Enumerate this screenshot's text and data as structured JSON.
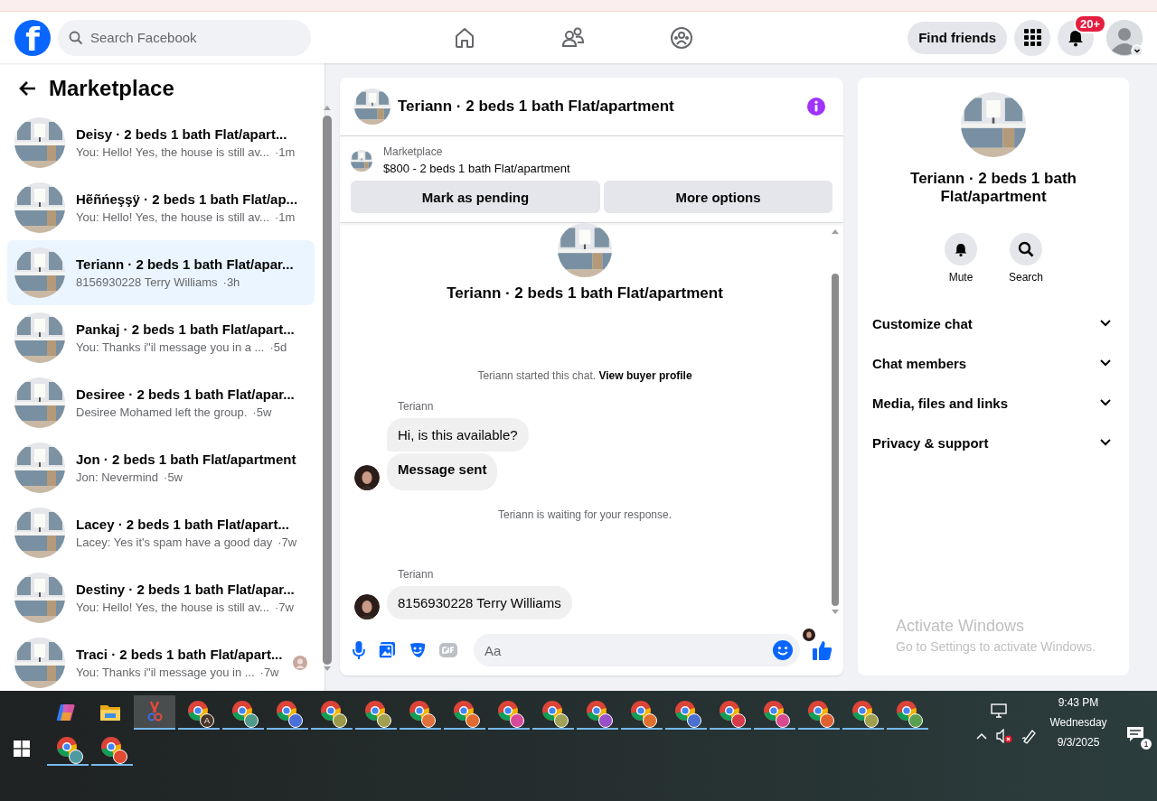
{
  "header": {
    "logo": "f",
    "search": {
      "placeholder": "Search Facebook"
    },
    "find_friends": "Find friends",
    "notification_badge": "20+"
  },
  "sidebar": {
    "title": "Marketplace",
    "conversations": [
      {
        "title": "Deisy · 2 beds 1 bath Flat/apart...",
        "preview": "You: Hello! Yes, the house is still av...",
        "time": "·1m",
        "selected": false,
        "seen": false
      },
      {
        "title": "Hẽñńeşşÿ · 2 beds 1 bath Flat/ap...",
        "preview": "You: Hello! Yes, the house is still av...",
        "time": "·1m",
        "selected": false,
        "seen": false
      },
      {
        "title": "Teriann · 2 beds 1 bath Flat/apar...",
        "preview": "8156930228 Terry Williams",
        "time": "·3h",
        "selected": true,
        "seen": false
      },
      {
        "title": "Pankaj · 2 beds 1 bath Flat/apart...",
        "preview": "You: Thanks i\"il message you in a ...",
        "time": "·5d",
        "selected": false,
        "seen": false
      },
      {
        "title": "Desiree · 2 beds 1 bath Flat/apar...",
        "preview": "Desiree Mohamed left the group.",
        "time": "·5w",
        "selected": false,
        "seen": false
      },
      {
        "title": "Jon · 2 beds 1 bath Flat/apartment",
        "preview": "Jon: Nevermind",
        "time": "·5w",
        "selected": false,
        "seen": false
      },
      {
        "title": "Lacey · 2 beds 1 bath Flat/apart...",
        "preview": "Lacey: Yes it's spam have a good day",
        "time": "·7w",
        "selected": false,
        "seen": false
      },
      {
        "title": "Destiny · 2 beds 1 bath Flat/apar...",
        "preview": "You: Hello! Yes, the house is still av...",
        "time": "·7w",
        "selected": false,
        "seen": false
      },
      {
        "title": "Traci · 2 beds 1 bath Flat/apart...",
        "preview": "You: Thanks i\"il message you in ...",
        "time": "·7w",
        "selected": false,
        "seen": true
      }
    ]
  },
  "chat": {
    "title": "Teriann · 2 beds 1 bath Flat/apartment",
    "listing": {
      "label": "Marketplace",
      "text": "$800 - 2 beds 1 bath Flat/apartment"
    },
    "buttons": [
      "Mark as pending",
      "More options"
    ],
    "thread_title": "Teriann · 2 beds 1 bath Flat/apartment",
    "messages": [
      {
        "kind": "notice",
        "text": "Teriann started this chat.",
        "link": "View buyer profile"
      },
      {
        "kind": "sender",
        "text": "Teriann"
      },
      {
        "kind": "bubble",
        "text": "Hi, is this available?",
        "avatar": false,
        "bold": false
      },
      {
        "kind": "bubble",
        "text": "Message sent",
        "avatar": true,
        "bold": true
      },
      {
        "kind": "notice",
        "text": "Teriann is waiting for your response."
      },
      {
        "kind": "sender",
        "text": "Teriann"
      },
      {
        "kind": "bubble",
        "text": "8156930228 Terry Williams",
        "avatar": true,
        "bold": false
      },
      {
        "kind": "seen"
      }
    ],
    "composer": {
      "placeholder": "Aa"
    }
  },
  "details": {
    "title": "Teriann · 2 beds 1 bath Flat/apartment",
    "actions": [
      {
        "kind": "mute",
        "label": "Mute"
      },
      {
        "kind": "search",
        "label": "Search"
      }
    ],
    "sections": [
      {
        "label": "Customize chat",
        "expanded": false
      },
      {
        "label": "Chat members",
        "expanded": false
      },
      {
        "label": "Media, files and links",
        "expanded": false
      },
      {
        "label": "Privacy & support",
        "expanded": false
      }
    ]
  },
  "activation": {
    "title": "Activate Windows",
    "subtitle": "Go to Settings to activate Windows."
  },
  "taskbar": {
    "apps": [
      {
        "kind": "copilot",
        "selected": false
      },
      {
        "kind": "folder",
        "selected": false
      },
      {
        "kind": "tool",
        "selected": true
      },
      {
        "kind": "chrome",
        "color": "#4a3426",
        "letter": "A",
        "selected": false
      },
      {
        "kind": "chrome",
        "color": "#4f9a8a",
        "selected": false
      },
      {
        "kind": "chrome",
        "color": "#4a6fd8",
        "selected": false
      },
      {
        "kind": "chrome",
        "color": "#9a9a4a",
        "selected": false
      },
      {
        "kind": "chrome",
        "color": "#a0a050",
        "selected": false
      },
      {
        "kind": "chrome",
        "color": "#e0703a",
        "selected": false
      },
      {
        "kind": "chrome",
        "color": "#e06a30",
        "selected": false
      },
      {
        "kind": "chrome",
        "color": "#d84a9a",
        "selected": false
      },
      {
        "kind": "chrome",
        "color": "#a0a058",
        "selected": false
      },
      {
        "kind": "chrome",
        "color": "#9a50c8",
        "selected": false
      },
      {
        "kind": "chrome",
        "color": "#e07030",
        "selected": false
      },
      {
        "kind": "chrome",
        "color": "#4a70d0",
        "selected": false
      },
      {
        "kind": "chrome",
        "color": "#d83a4a",
        "selected": false
      },
      {
        "kind": "chrome",
        "color": "#d84a90",
        "selected": false
      },
      {
        "kind": "chrome",
        "color": "#e06030",
        "selected": false
      },
      {
        "kind": "chrome",
        "color": "#a0a050",
        "selected": false
      },
      {
        "kind": "chrome",
        "color": "#5aa050",
        "selected": false
      }
    ],
    "pinned": [
      {
        "kind": "chrome",
        "color": "#4f9aa0",
        "selected": false
      },
      {
        "kind": "chrome",
        "color": "#e04a30",
        "selected": false
      }
    ],
    "time": "9:43 PM",
    "day": "Wednesday",
    "date": "9/3/2025",
    "notifications": "1"
  }
}
